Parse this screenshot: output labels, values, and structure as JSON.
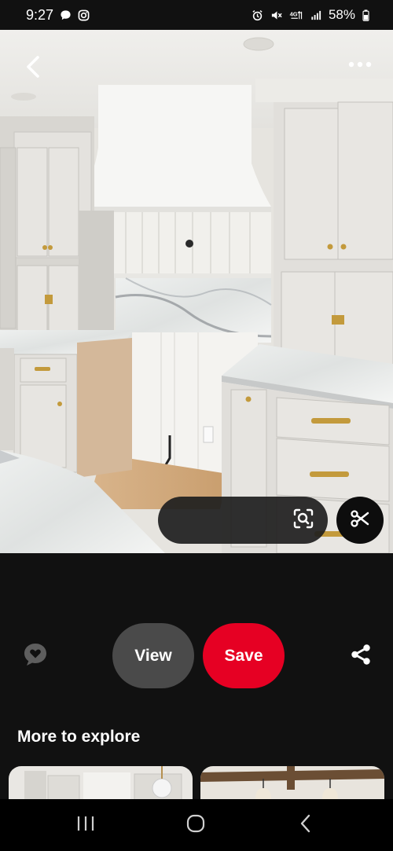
{
  "status_bar": {
    "time": "9:27",
    "battery": "58%"
  },
  "pin": {
    "description": "Light gray shaker kitchen cabinets with brass hardware, white plaster range hood, vertical shiplap backsplash and white marble countertops"
  },
  "actions": {
    "view_label": "View",
    "save_label": "Save"
  },
  "explore": {
    "title": "More to explore"
  },
  "icons": {
    "back": "back-arrow-icon",
    "more": "more-dots-icon",
    "lens": "visual-search-icon",
    "scissors": "scissors-icon",
    "react": "heart-bubble-icon",
    "share": "share-icon",
    "recents": "recents-icon",
    "home": "home-icon",
    "nav_back": "nav-back-icon"
  },
  "colors": {
    "save": "#e60023",
    "view": "#4a4a4a",
    "background": "#111111"
  }
}
